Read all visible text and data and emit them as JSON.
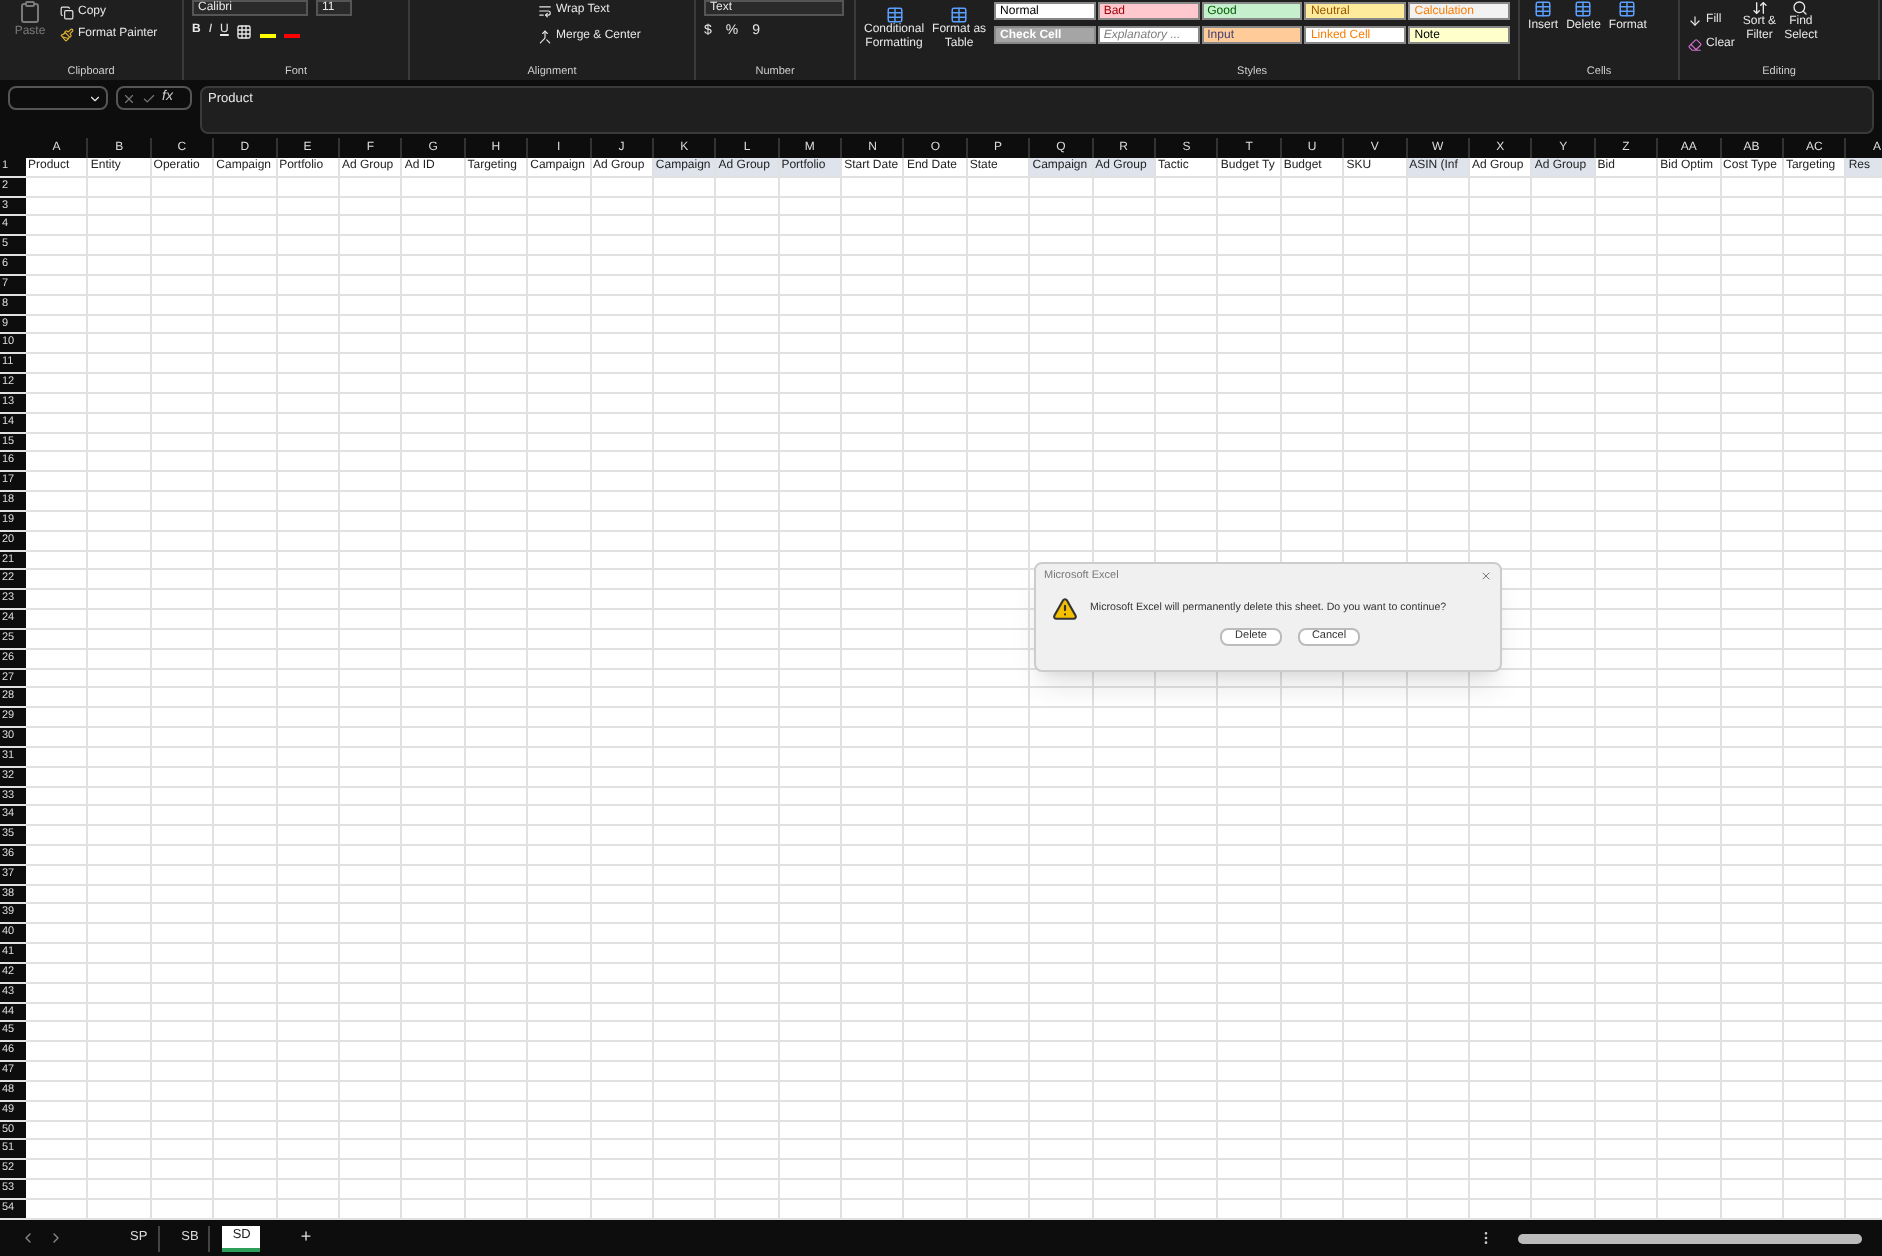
{
  "ribbon": {
    "clipboard": {
      "paste": "Paste",
      "copy": "Copy",
      "format_painter": "Format Painter",
      "label": "Clipboard"
    },
    "font": {
      "font_name": "Calibri",
      "font_size": "11",
      "bold": "B",
      "italic": "I",
      "underline": "U",
      "label": "Font"
    },
    "alignment": {
      "wrap_text": "Wrap Text",
      "merge_center": "Merge & Center",
      "label": "Alignment"
    },
    "number": {
      "format": "Text",
      "currency": "$",
      "percent": "%",
      "comma": "9",
      "label": "Number"
    },
    "conditional_formatting": [
      "Conditional",
      "Formatting"
    ],
    "format_as_table": [
      "Format as",
      "Table"
    ],
    "styles": [
      {
        "label": "Normal",
        "color": "#ffffff",
        "kind": "normal"
      },
      {
        "label": "Bad",
        "color": "#ffc7ce",
        "kind": "bad"
      },
      {
        "label": "Good",
        "color": "#c6efce",
        "kind": "good"
      },
      {
        "label": "Neutral",
        "color": "#ffeb9c",
        "kind": "neutral"
      },
      {
        "label": "Calculation",
        "color": "#f2f2f2",
        "kind": "calculation"
      },
      {
        "label": "Check Cell",
        "color": "#a5a5a5",
        "kind": "check"
      },
      {
        "label": "Explanatory ...",
        "color": "#ffffff",
        "kind": "explanatory"
      },
      {
        "label": "Input",
        "color": "#ffcc99",
        "kind": "input"
      },
      {
        "label": "Linked Cell",
        "color": "#ffffff",
        "kind": "linked"
      },
      {
        "label": "Note",
        "color": "#ffffcc",
        "kind": "note"
      }
    ],
    "styles_label": "Styles",
    "cells": {
      "insert": "Insert",
      "delete": "Delete",
      "format": "Format",
      "label": "Cells"
    },
    "editing": {
      "fill": "Fill",
      "clear": "Clear",
      "sort_filter": [
        "Sort &",
        "Filter"
      ],
      "find_select": [
        "Find",
        "Select"
      ],
      "label": "Editing"
    }
  },
  "formula_bar": {
    "function_label": "fx",
    "value": "Product"
  },
  "columns": [
    "A",
    "B",
    "C",
    "D",
    "E",
    "F",
    "G",
    "H",
    "I",
    "J",
    "K",
    "L",
    "M",
    "N",
    "O",
    "P",
    "Q",
    "R",
    "S",
    "T",
    "U",
    "V",
    "W",
    "X",
    "Y",
    "Z",
    "AA",
    "AB",
    "AC",
    "A"
  ],
  "header_row": [
    {
      "text": "Product",
      "highlighted": false
    },
    {
      "text": "Entity",
      "highlighted": false
    },
    {
      "text": "Operatio",
      "highlighted": false
    },
    {
      "text": "Campaign",
      "highlighted": false
    },
    {
      "text": "Portfolio",
      "highlighted": false
    },
    {
      "text": "Ad Group",
      "highlighted": false
    },
    {
      "text": "Ad ID",
      "highlighted": false
    },
    {
      "text": "Targeting",
      "highlighted": false
    },
    {
      "text": "Campaign",
      "highlighted": false
    },
    {
      "text": "Ad Group",
      "highlighted": false
    },
    {
      "text": "Campaign",
      "highlighted": true
    },
    {
      "text": "Ad Group",
      "highlighted": true
    },
    {
      "text": "Portfolio",
      "highlighted": true
    },
    {
      "text": "Start Date",
      "highlighted": false
    },
    {
      "text": "End Date",
      "highlighted": false
    },
    {
      "text": "State",
      "highlighted": false
    },
    {
      "text": "Campaign",
      "highlighted": true
    },
    {
      "text": "Ad Group",
      "highlighted": true
    },
    {
      "text": "Tactic",
      "highlighted": false
    },
    {
      "text": "Budget Ty",
      "highlighted": false
    },
    {
      "text": "Budget",
      "highlighted": false
    },
    {
      "text": "SKU",
      "highlighted": false
    },
    {
      "text": "ASIN (Inf",
      "highlighted": true
    },
    {
      "text": "Ad Group",
      "highlighted": false
    },
    {
      "text": "Ad Group",
      "highlighted": true
    },
    {
      "text": "Bid",
      "highlighted": false
    },
    {
      "text": "Bid Optim",
      "highlighted": false
    },
    {
      "text": "Cost Type",
      "highlighted": false
    },
    {
      "text": "Targeting",
      "highlighted": false
    },
    {
      "text": "Res",
      "highlighted": true
    }
  ],
  "row_numbers": [
    "1",
    "2",
    "3",
    "4",
    "5",
    "6",
    "7",
    "8",
    "9",
    "10",
    "11",
    "12",
    "13",
    "14",
    "15",
    "16",
    "17",
    "18",
    "19",
    "20",
    "21",
    "22",
    "23",
    "24",
    "25",
    "26",
    "27",
    "28",
    "29",
    "30",
    "31",
    "32",
    "33",
    "34",
    "35",
    "36",
    "37",
    "38",
    "39",
    "40",
    "41",
    "42",
    "43",
    "44",
    "45",
    "46",
    "47",
    "48",
    "49",
    "50",
    "51",
    "52",
    "53",
    "54"
  ],
  "sheet_tabs": [
    {
      "label": "SP",
      "selected": false
    },
    {
      "label": "SB",
      "selected": false
    },
    {
      "label": "SD",
      "selected": true
    }
  ],
  "add_sheet": "+",
  "dialog": {
    "title": "Microsoft Excel",
    "message": "Microsoft Excel will permanently delete this sheet. Do you want to continue?",
    "buttons": [
      "Delete",
      "Cancel"
    ]
  }
}
